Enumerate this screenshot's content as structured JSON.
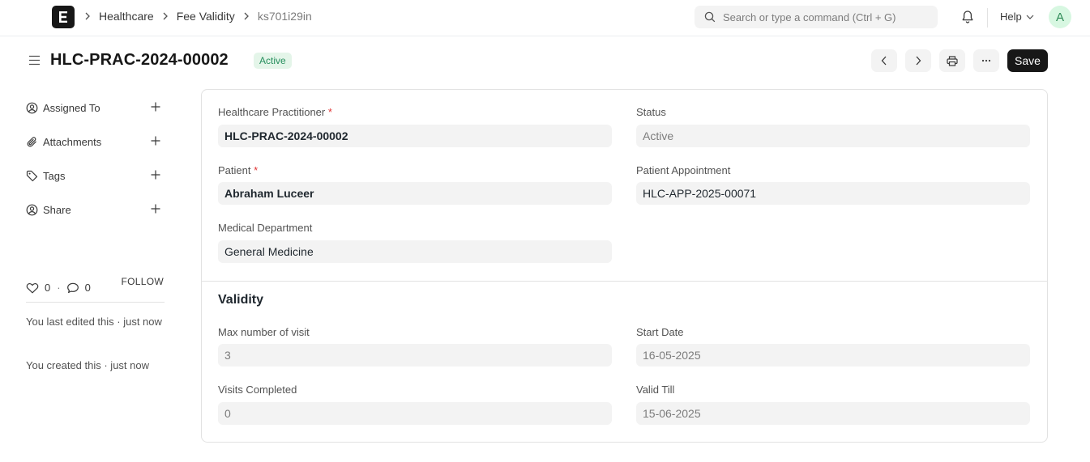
{
  "navbar": {
    "logo_letter": "E",
    "breadcrumbs": [
      "Healthcare",
      "Fee Validity",
      "ks701i29in"
    ],
    "search_placeholder": "Search or type a command (Ctrl + G)",
    "help_label": "Help",
    "avatar_initial": "A"
  },
  "page": {
    "title": "HLC-PRAC-2024-00002",
    "status_badge": "Active",
    "save_label": "Save"
  },
  "sidebar": {
    "items": [
      {
        "label": "Assigned To",
        "icon": "assign-user-icon"
      },
      {
        "label": "Attachments",
        "icon": "paperclip-icon"
      },
      {
        "label": "Tags",
        "icon": "tag-icon"
      },
      {
        "label": "Share",
        "icon": "share-user-icon"
      }
    ],
    "likes": "0",
    "comments": "0",
    "stats_sep": "·",
    "follow_label": "FOLLOW",
    "last_edited": "You last edited this · just now",
    "created": "You created this · just now"
  },
  "form": {
    "practitioner_label": "Healthcare Practitioner",
    "practitioner_value": "HLC-PRAC-2024-00002",
    "status_label": "Status",
    "status_value": "Active",
    "patient_label": "Patient",
    "patient_value": "Abraham Luceer",
    "appointment_label": "Patient Appointment",
    "appointment_value": "HLC-APP-2025-00071",
    "department_label": "Medical Department",
    "department_value": "General Medicine",
    "required_marker": "*",
    "validity_title": "Validity",
    "max_visits_label": "Max number of visit",
    "max_visits_value": "3",
    "start_date_label": "Start Date",
    "start_date_value": "16-05-2025",
    "visits_completed_label": "Visits Completed",
    "visits_completed_value": "0",
    "valid_till_label": "Valid Till",
    "valid_till_value": "15-06-2025"
  },
  "colors": {
    "accent_dark": "#171717",
    "badge_bg": "#e4f5e9",
    "badge_text": "#278f5e",
    "field_bg": "#f3f3f3",
    "required": "#e03636"
  }
}
